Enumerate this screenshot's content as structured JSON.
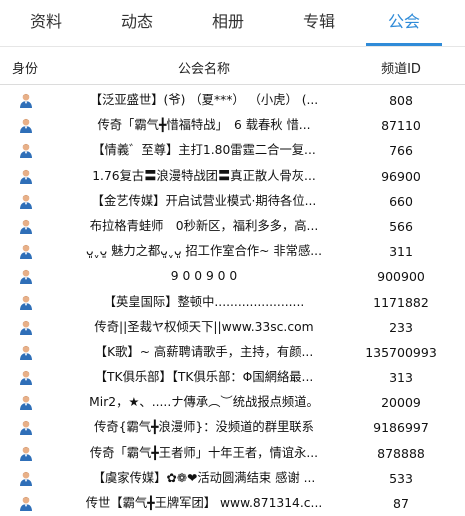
{
  "tabs": [
    {
      "label": "资料"
    },
    {
      "label": "动态"
    },
    {
      "label": "相册"
    },
    {
      "label": "专辑"
    },
    {
      "label": "公会"
    }
  ],
  "accent_color": "#2f8bd8",
  "table": {
    "headers": {
      "role": "身份",
      "name": "公会名称",
      "channel": "频道ID"
    },
    "rows": [
      {
        "role_icon": "user-avatar-icon",
        "name": "【泛亚盛世】(爷) （夏***） （小虎） (...",
        "channel": "808"
      },
      {
        "role_icon": "user-avatar-icon",
        "name": "传奇「霸气╋惜福特战」　6 载春秋 惜...",
        "channel": "87110"
      },
      {
        "role_icon": "user-avatar-icon",
        "name": "【情義゛至尊】主打1.80雷霆二合一复...",
        "channel": "766"
      },
      {
        "role_icon": "user-avatar-icon",
        "name": "1.76复古〓浪漫特战团〓真正散人骨灰...",
        "channel": "96900"
      },
      {
        "role_icon": "user-avatar-icon",
        "name": "【金艺传媒】开启试营业模式·期待各位...",
        "channel": "660"
      },
      {
        "role_icon": "user-avatar-icon",
        "name": "布拉格青蛙师　0秒新区，福利多多，高...",
        "channel": "566"
      },
      {
        "role_icon": "user-avatar-icon",
        "name": "ᴗ͈ˬᴗ͈ 魅力之都ᴗ͈ˬᴗ͈ 招工作室合作~ 非常感...",
        "channel": "311"
      },
      {
        "role_icon": "user-avatar-icon",
        "name": "9 0 0 9 0 0",
        "channel": "900900"
      },
      {
        "role_icon": "user-avatar-icon",
        "name": "【英皇国际】整顿中.......................",
        "channel": "1171882"
      },
      {
        "role_icon": "user-avatar-icon",
        "name": "传奇||圣裁ヤ权倾天下||www.33sc.com",
        "channel": "233"
      },
      {
        "role_icon": "user-avatar-icon",
        "name": "【K歌】~ 高薪聘请歌手，主持，有颜...",
        "channel": "135700993"
      },
      {
        "role_icon": "user-avatar-icon",
        "name": "【TK俱乐部】【TK俱乐部：Φ国網絡最...",
        "channel": "313"
      },
      {
        "role_icon": "user-avatar-icon",
        "name": "Mir2，★、.....ナ傳承︵︶统战报点频道。",
        "channel": "20009"
      },
      {
        "role_icon": "user-avatar-icon",
        "name": "传奇{霸气╋浪漫师}：没频道的群里联系",
        "channel": "9186997"
      },
      {
        "role_icon": "user-avatar-icon",
        "name": "传奇「霸气╋王者师」十年王者，情谊永...",
        "channel": "878888"
      },
      {
        "role_icon": "user-avatar-icon",
        "name": "【虞家传媒】✿❁❤活动圆满结束 感谢 ...",
        "channel": "533"
      },
      {
        "role_icon": "user-avatar-icon",
        "name": "传世【霸气╋王牌军团】 www.871314.c...",
        "channel": "87"
      }
    ]
  }
}
